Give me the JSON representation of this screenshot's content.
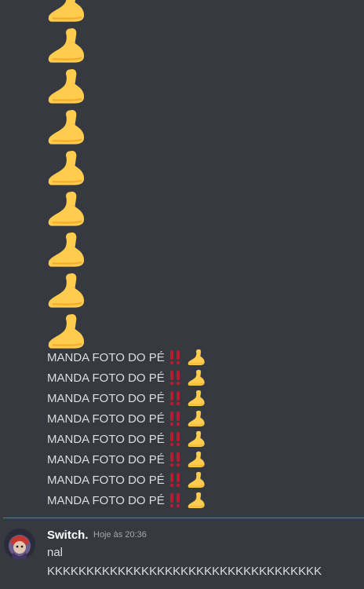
{
  "messages": {
    "big_emoji_icon": "foot-emoji",
    "big_emoji_count": 9,
    "lines": [
      {
        "text": "MANDA FOTO DO PÉ",
        "emoji1": "double-exclamation-icon",
        "emoji2": "foot-emoji"
      },
      {
        "text": "MANDA FOTO DO PÉ",
        "emoji1": "double-exclamation-icon",
        "emoji2": "foot-emoji"
      },
      {
        "text": "MANDA FOTO DO PÉ",
        "emoji1": "double-exclamation-icon",
        "emoji2": "foot-emoji"
      },
      {
        "text": "MANDA FOTO DO PÉ",
        "emoji1": "double-exclamation-icon",
        "emoji2": "foot-emoji"
      },
      {
        "text": "MANDA FOTO DO PÉ",
        "emoji1": "double-exclamation-icon",
        "emoji2": "foot-emoji"
      },
      {
        "text": "MANDA FOTO DO PÉ",
        "emoji1": "double-exclamation-icon",
        "emoji2": "foot-emoji"
      },
      {
        "text": "MANDA FOTO DO PÉ",
        "emoji1": "double-exclamation-icon",
        "emoji2": "foot-emoji"
      },
      {
        "text": "MANDA FOTO DO PÉ",
        "emoji1": "double-exclamation-icon",
        "emoji2": "foot-emoji"
      }
    ]
  },
  "new_message": {
    "username": "Switch.",
    "timestamp": "Hoje às 20:36",
    "line1": "nal",
    "line2": "KKKKKKKKKKKKKKKKKKKKKKKKKKKKKKKKKKK"
  },
  "colors": {
    "background": "#36393f",
    "text": "#dcddde",
    "username": "#ffffff",
    "timestamp": "#a3a6aa",
    "new_messages_divider": "#ed4245",
    "emoji_foot": "#ffcc4d",
    "emoji_bang": "#be1931"
  }
}
